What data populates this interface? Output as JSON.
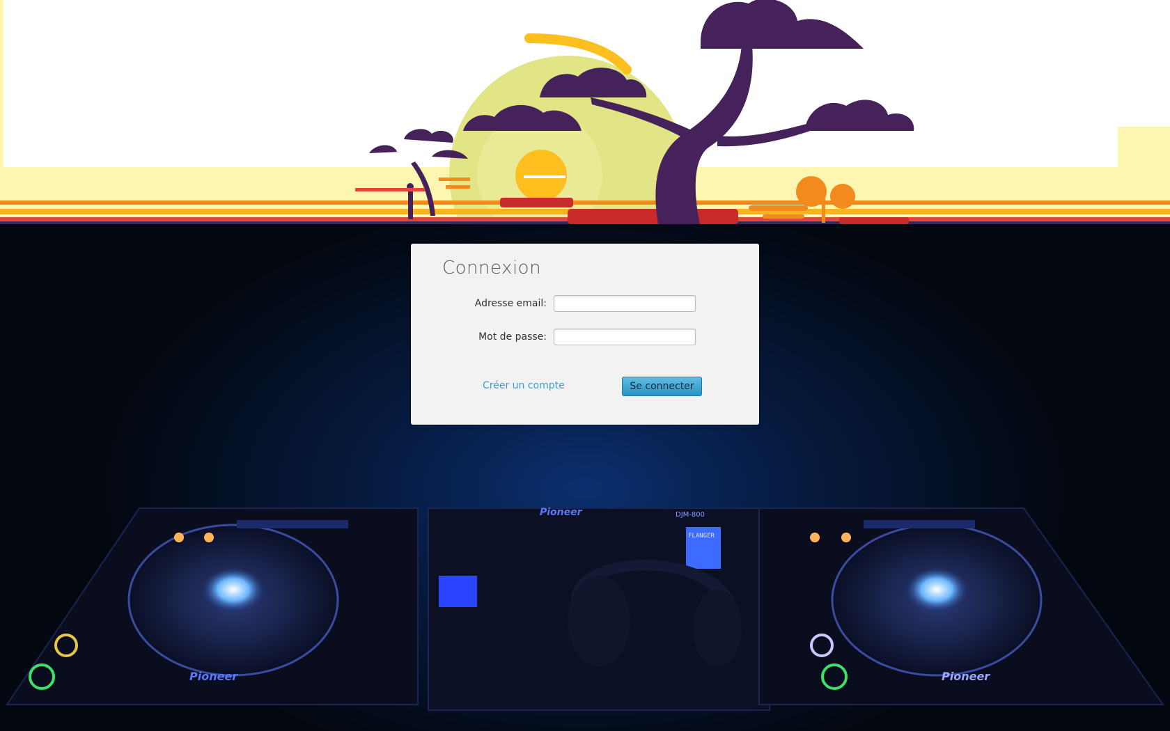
{
  "login": {
    "title": "Connexion",
    "email_label": "Adresse email:",
    "email_value": "",
    "password_label": "Mot de passe:",
    "password_value": "",
    "create_account_link": "Créer un compte",
    "submit_label": "Se connecter"
  },
  "decks": {
    "left_brand": "Pioneer",
    "mixer_brand": "Pioneer",
    "right_brand": "Pioneer",
    "mixer_model": "DJM-800",
    "mixer_screen": "FLANGER"
  },
  "colors": {
    "banner_purple": "#45225a",
    "banner_sun": "#fcbf1e",
    "banner_pale": "#fdf6b0",
    "banner_orange": "#f28a1e",
    "card_bg": "#f2f2f2",
    "link": "#3a9fce",
    "button": "#2a93c4"
  }
}
